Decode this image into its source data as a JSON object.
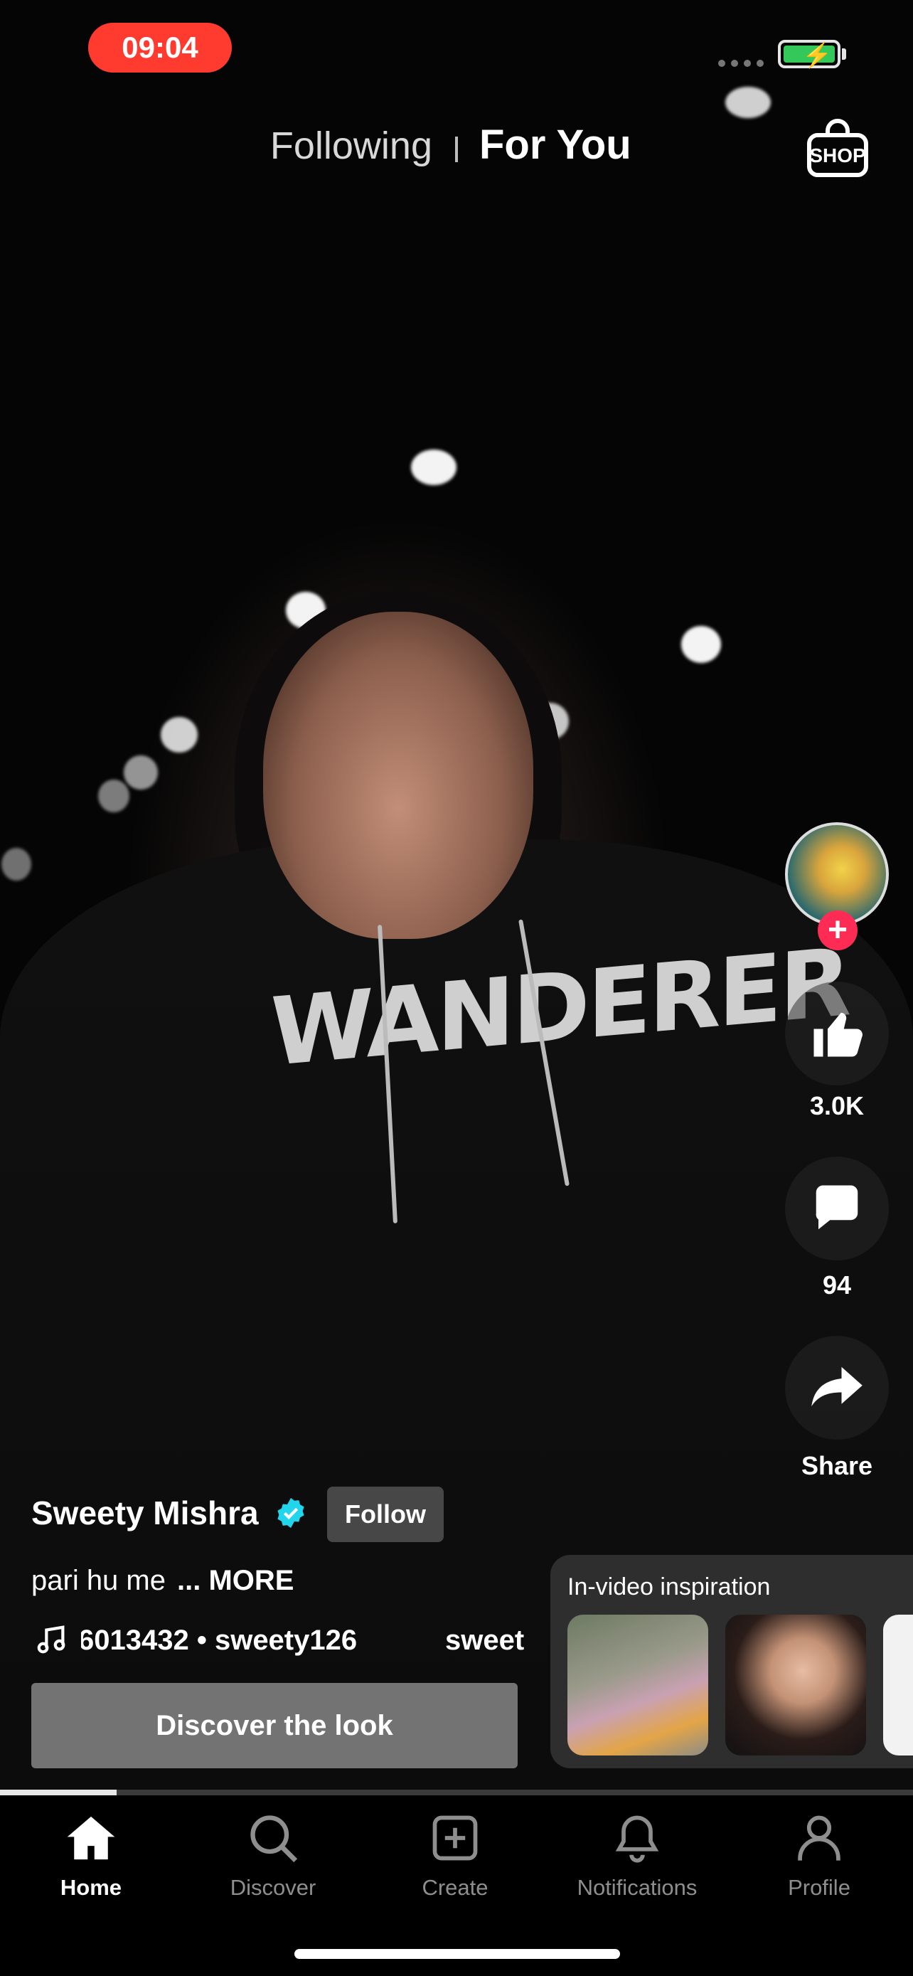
{
  "status_bar": {
    "time": "09:04"
  },
  "top_tabs": {
    "following": "Following",
    "for_you": "For You",
    "shop_icon": "shopping-bag-icon",
    "shop_label": "SHOP"
  },
  "video": {
    "hoodie_text": "WANDERER"
  },
  "rail": {
    "like_count": "3.0K",
    "comment_count": "94",
    "share_label": "Share"
  },
  "post": {
    "username": "Sweety Mishra",
    "follow_label": "Follow",
    "caption": "pari hu me",
    "more_label": "... MORE",
    "music_text": "6013432 • sweety126",
    "music_text_2": "sweet",
    "discover_label": "Discover the look"
  },
  "inspiration": {
    "title": "In-video inspiration"
  },
  "progress": {
    "fraction": 0.128
  },
  "tabbar": {
    "items": [
      {
        "label": "Home",
        "icon": "home-icon"
      },
      {
        "label": "Discover",
        "icon": "search-icon"
      },
      {
        "label": "Create",
        "icon": "plus-square-icon"
      },
      {
        "label": "Notifications",
        "icon": "bell-icon"
      },
      {
        "label": "Profile",
        "icon": "person-icon"
      }
    ]
  },
  "colors": {
    "accent": "#fe2c55",
    "time_pill": "#ff3b30",
    "battery": "#34c759",
    "verified": "#20d5ec"
  }
}
